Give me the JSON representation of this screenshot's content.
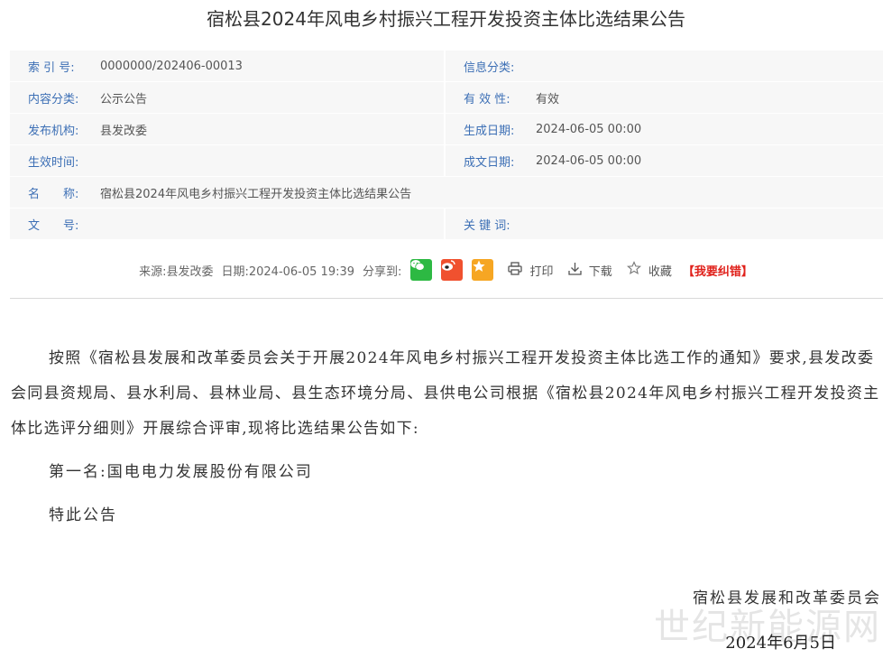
{
  "page_title": "宿松县2024年风电乡村振兴工程开发投资主体比选结果公告",
  "meta": {
    "index_label": "索 引 号:",
    "index_value": "0000000/202406-00013",
    "info_class_label": "信息分类:",
    "info_class_value": "",
    "content_class_label": "内容分类:",
    "content_class_value": "公示公告",
    "validity_label": "有 效 性:",
    "validity_value": "有效",
    "publisher_label": "发布机构:",
    "publisher_value": "县发改委",
    "created_label": "生成日期:",
    "created_value": "2024-06-05 00:00",
    "effective_label": "生效时间:",
    "effective_value": "",
    "drafted_label": "成文日期:",
    "drafted_value": "2024-06-05 00:00",
    "name_label": "名　　称:",
    "name_value": "宿松县2024年风电乡村振兴工程开发投资主体比选结果公告",
    "docno_label": "文　　号:",
    "docno_value": "",
    "keywords_label": "关 键 词:",
    "keywords_value": ""
  },
  "source_bar": {
    "source": "来源:县发改委",
    "date": "日期:2024-06-05 19:39",
    "share_label": "分享到:",
    "print_label": "打印",
    "download_label": "下载",
    "favorite_label": "收藏",
    "error_label": "【我要纠错】"
  },
  "body": {
    "paragraph1": "按照《宿松县发展和改革委员会关于开展2024年风电乡村振兴工程开发投资主体比选工作的通知》要求,县发改委会同县资规局、县水利局、县林业局、县生态环境分局、县供电公司根据《宿松县2024年风电乡村振兴工程开发投资主体比选评分细则》开展综合评审,现将比选结果公告如下:",
    "rank1": "第一名:国电电力发展股份有限公司",
    "closing": "特此公告",
    "signer": "宿松县发展和改革委员会",
    "sign_date": "2024年6月5日"
  },
  "watermark": "世纪新能源网",
  "colors": {
    "label_blue": "#3c6fb5",
    "wechat_green": "#2db943",
    "weibo_orange": "#f0512f",
    "qzone_yellow": "#f6a623",
    "error_red": "#e0211b"
  }
}
